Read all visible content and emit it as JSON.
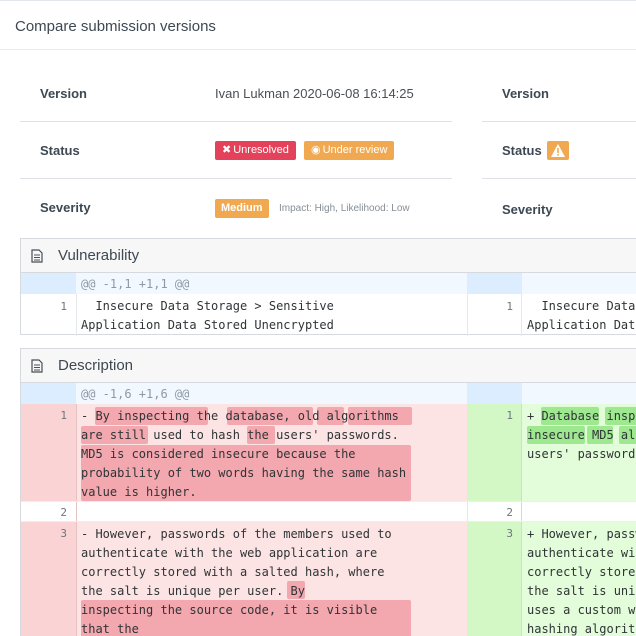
{
  "page": {
    "title": "Compare submission versions"
  },
  "left": {
    "version_label": "Version",
    "version_value": "Ivan Lukman 2020-06-08 16:14:25",
    "status_label": "Status",
    "status_badges": [
      "Unresolved",
      "Under review"
    ],
    "severity_label": "Severity",
    "severity_badge": "Medium",
    "severity_note": "Impact: High, Likelihood: Low"
  },
  "right": {
    "version_label": "Version",
    "status_label": "Status",
    "severity_label": "Severity"
  },
  "vulnerability": {
    "title": "Vulnerability",
    "hunk": "@@ -1,1 +1,1 @@",
    "left_num": "1",
    "right_num": "1",
    "left_lines": [
      "  Insecure Data Storage > Sensitive",
      "Application Data Stored Unencrypted"
    ],
    "right_lines": [
      "  Insecure Data",
      "Application Data"
    ]
  },
  "description": {
    "title": "Description",
    "hunk": "@@ -1,6 +1,6 @@",
    "rows": [
      {
        "left_num": "1",
        "right_num": "1"
      },
      {
        "left_num": "2",
        "right_num": "2"
      },
      {
        "left_num": "3",
        "right_num": "3"
      }
    ],
    "left_block1": [
      "- By inspecting the database, old algorithms",
      "are still used to hash the users' passwords.",
      "MD5 is considered insecure because the",
      "probability of two words having the same hash",
      "value is higher."
    ],
    "right_block1": [
      "+ Database inspe",
      "insecure MD5 alg",
      "users' passwords"
    ],
    "left_block3": [
      "- However, passwords of the members used to",
      "authenticate with the web application are",
      "correctly stored with a salted hash, where",
      "the salt is unique per user. By",
      "inspecting the source code, it is visible",
      "that the"
    ],
    "right_block3": [
      "+ However, passw",
      "authenticate wit",
      "correctly stored",
      "the salt is uniq",
      "uses a custom wh",
      "hashing algorith"
    ]
  },
  "colors": {
    "del_bg": "#fce4e4",
    "del_hl": "#f3a7ae",
    "add_bg": "#e3fcd9",
    "add_hl": "#9ee890",
    "badge_red": "#e3425a",
    "badge_orange": "#f0a950"
  }
}
